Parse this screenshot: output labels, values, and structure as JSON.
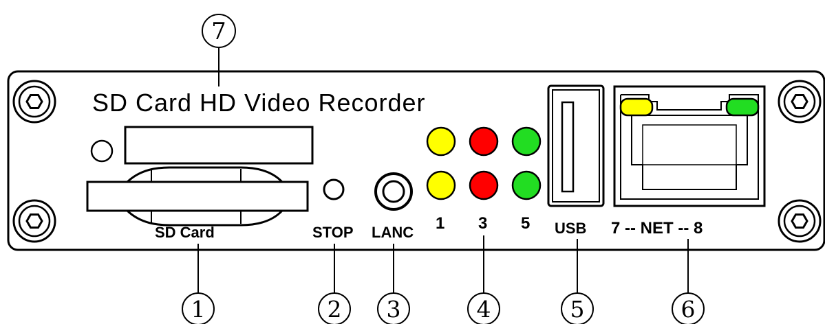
{
  "panel": {
    "title": "SD Card HD Video Recorder"
  },
  "labels": {
    "sd_card": "SD Card",
    "stop": "STOP",
    "lanc": "LANC",
    "led_1": "1",
    "led_3": "3",
    "led_5": "5",
    "usb": "USB",
    "net": "7 -- NET -- 8"
  },
  "callouts": {
    "c1": "1",
    "c2": "2",
    "c3": "3",
    "c4": "4",
    "c5": "5",
    "c6": "6",
    "c7": "7"
  },
  "colors": {
    "led_yellow": "#ffff00",
    "led_red": "#ff0000",
    "led_green": "#22dd22",
    "outline": "#000000"
  }
}
